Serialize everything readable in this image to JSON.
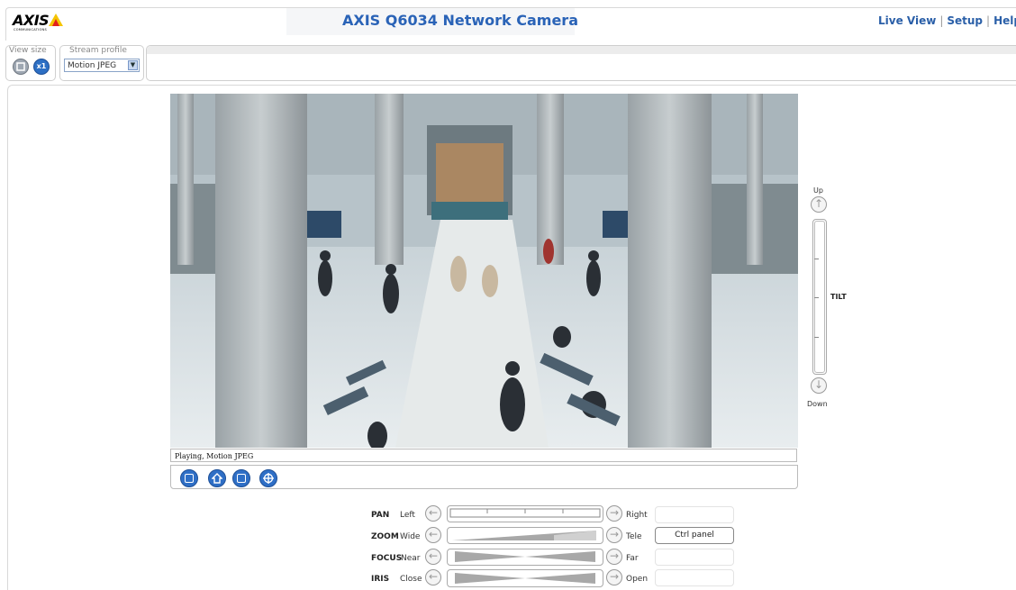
{
  "header": {
    "logo_text": "AXIS",
    "logo_tagline": "COMMUNICATIONS",
    "title": "AXIS Q6034 Network Camera",
    "nav": {
      "live_view": "Live View",
      "sep1": "|",
      "setup": "Setup",
      "sep2": "|",
      "help": "Help"
    }
  },
  "toolbar": {
    "view_size_label": "View size",
    "view_size_buttons": [
      {
        "icon": "fit-window-icon"
      },
      {
        "icon": "scale-1x-icon",
        "text": "x1"
      }
    ],
    "stream_profile_label": "Stream profile",
    "stream_profile_value": "Motion JPEG"
  },
  "video": {
    "status": "Playing, Motion JPEG",
    "buttons": [
      "stop-icon",
      "home-icon",
      "snapshot-icon",
      "center-icon"
    ]
  },
  "tilt": {
    "up": "Up",
    "label": "TILT",
    "down": "Down"
  },
  "ptz": {
    "pan": {
      "label": "PAN",
      "min": "Left",
      "max": "Right"
    },
    "zoom": {
      "label": "ZOOM",
      "min": "Wide",
      "max": "Tele"
    },
    "focus": {
      "label": "FOCUS",
      "min": "Near",
      "max": "Far"
    },
    "iris": {
      "label": "IRIS",
      "min": "Close",
      "max": "Open"
    },
    "ctrl_panel": "Ctrl panel"
  },
  "colors": {
    "title_blue": "#2a63b7",
    "button_blue": "#2f6fc6",
    "logo_yellow": "#f5c400"
  }
}
